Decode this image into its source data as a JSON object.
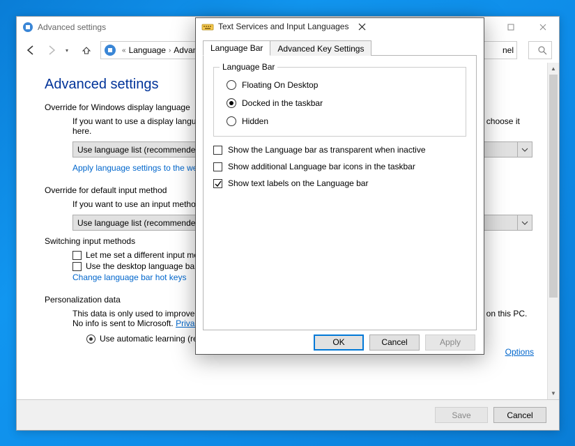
{
  "back_window": {
    "title": "Advanced settings",
    "breadcrumb": {
      "seg1": "Language",
      "seg2": "Advanced settings",
      "tail_suffix": "nel"
    },
    "page_heading": "Advanced settings",
    "override_display": {
      "label": "Override for Windows display language",
      "desc": "If you want to use a display language that's different than the one determined by the order of your language list, choose it here.",
      "combo_value": "Use language list (recommended)",
      "link": "Apply language settings to the welcome screen, system accounts, and new user accounts"
    },
    "override_input": {
      "label": "Override for default input method",
      "desc": "If you want to use an input method that's different than the first one in your language list, choose it here.",
      "combo_value": "Use language list (recommended)"
    },
    "switching": {
      "label": "Switching input methods",
      "cb1": "Let me set a different input method for each app window",
      "cb2": "Use the desktop language bar when it's available",
      "options_link": "Options",
      "link": "Change language bar hot keys"
    },
    "personalization": {
      "label": "Personalization data",
      "desc_pre": "This data is only used to improve handwriting recognition and text prediction results for languages without IMEs on this PC. No info is sent to Microsoft. ",
      "privacy": "Privacy statement",
      "r1": "Use automatic learning (recommended)"
    },
    "footer": {
      "save": "Save",
      "cancel": "Cancel"
    }
  },
  "dialog": {
    "title": "Text Services and Input Languages",
    "tabs": {
      "t1": "Language Bar",
      "t2": "Advanced Key Settings"
    },
    "group_legend": "Language Bar",
    "radios": {
      "r1": "Floating On Desktop",
      "r2": "Docked in the taskbar",
      "r3": "Hidden"
    },
    "checks": {
      "c1": "Show the Language bar as transparent when inactive",
      "c2": "Show additional Language bar icons in the taskbar",
      "c3": "Show text labels on the Language bar"
    },
    "buttons": {
      "ok": "OK",
      "cancel": "Cancel",
      "apply": "Apply"
    }
  }
}
